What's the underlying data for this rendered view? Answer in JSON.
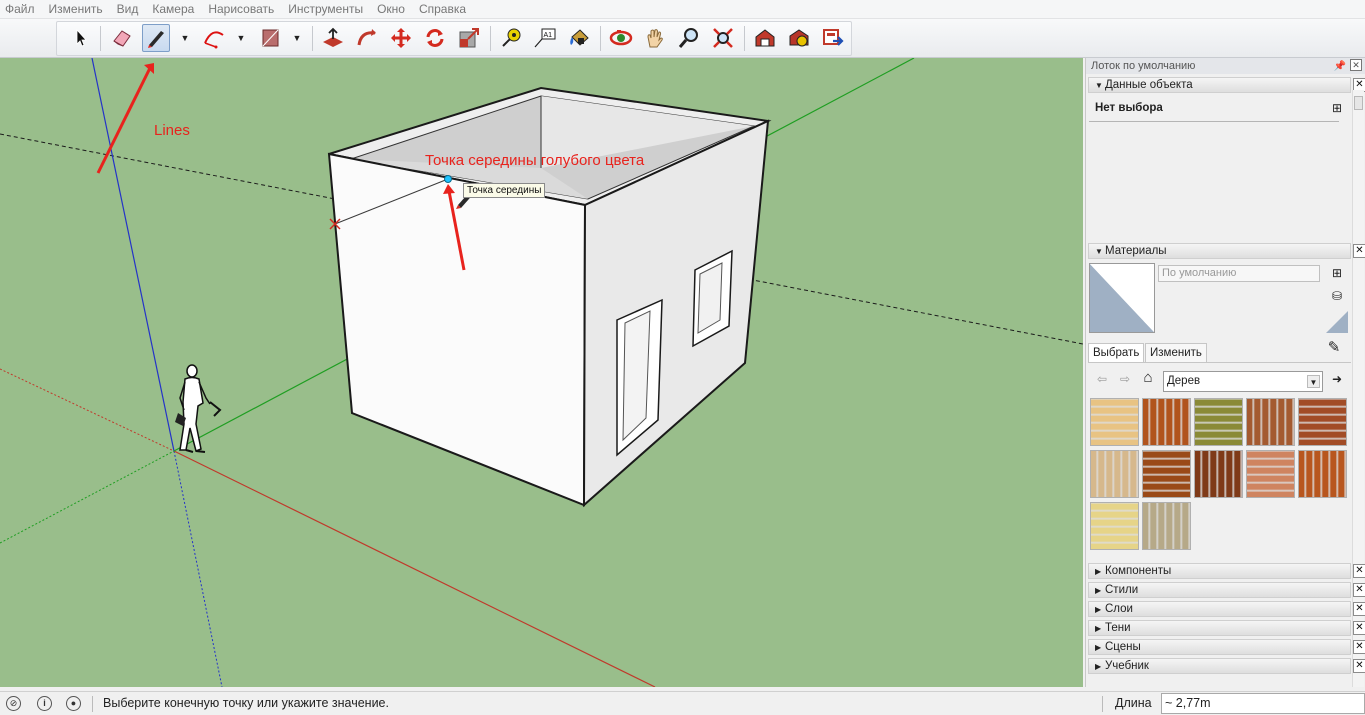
{
  "menu": {
    "items": [
      "Файл",
      "Изменить",
      "Вид",
      "Камера",
      "Нарисовать",
      "Инструменты",
      "Окно",
      "Справка"
    ]
  },
  "toolbar": {
    "tools": [
      {
        "name": "select-icon"
      },
      {
        "name": "eraser-icon"
      },
      {
        "name": "pencil-line-icon",
        "active": true
      },
      {
        "name": "arc-icon"
      },
      {
        "name": "rectangle-icon"
      },
      {
        "name": "push-pull-icon"
      },
      {
        "name": "follow-me-icon"
      },
      {
        "name": "move-icon"
      },
      {
        "name": "rotate-icon"
      },
      {
        "name": "scale-icon"
      },
      {
        "name": "tape-measure-icon"
      },
      {
        "name": "text-icon"
      },
      {
        "name": "paint-bucket-icon"
      },
      {
        "name": "orbit-icon"
      },
      {
        "name": "pan-icon"
      },
      {
        "name": "zoom-icon"
      },
      {
        "name": "zoom-extents-icon"
      },
      {
        "name": "warehouse-icon"
      },
      {
        "name": "extension-warehouse-icon"
      },
      {
        "name": "share-model-icon"
      }
    ],
    "text_tool_label": "A1"
  },
  "viewport": {
    "annotation_lines": "Lines",
    "annotation_midpoint": "Точка середины голубого цвета",
    "tooltip": "Точка середины",
    "colors": {
      "background": "#99be8b",
      "red_axis": "#c0392b",
      "green_axis": "#1f9e22",
      "blue_axis": "#2433c8",
      "annotation": "#e8231d",
      "midpoint": "#1ec3ff"
    }
  },
  "tray": {
    "title": "Лоток по умолчанию",
    "entity_info": {
      "header": "Данные объекта",
      "value": "Нет выбора"
    },
    "materials": {
      "header": "Материалы",
      "name_placeholder": "По умолчанию",
      "tabs": [
        "Выбрать",
        "Изменить"
      ],
      "active_tab": "Выбрать",
      "library": "Дерев",
      "swatch_colors": [
        "#e8c383",
        "#b1541d",
        "#8a8a36",
        "#a45a30",
        "#a24c26",
        "#d6b88c",
        "#9a4a18",
        "#7f3a18",
        "#cf8460",
        "#b8561e",
        "#e6d488",
        "#b6a988"
      ]
    },
    "collapsed_panels": [
      "Компоненты",
      "Стили",
      "Слои",
      "Тени",
      "Сцены",
      "Учебник"
    ]
  },
  "status": {
    "message": "Выберите конечную точку или укажите значение.",
    "measure_label": "Длина",
    "measure_value": "~ 2,77m"
  }
}
